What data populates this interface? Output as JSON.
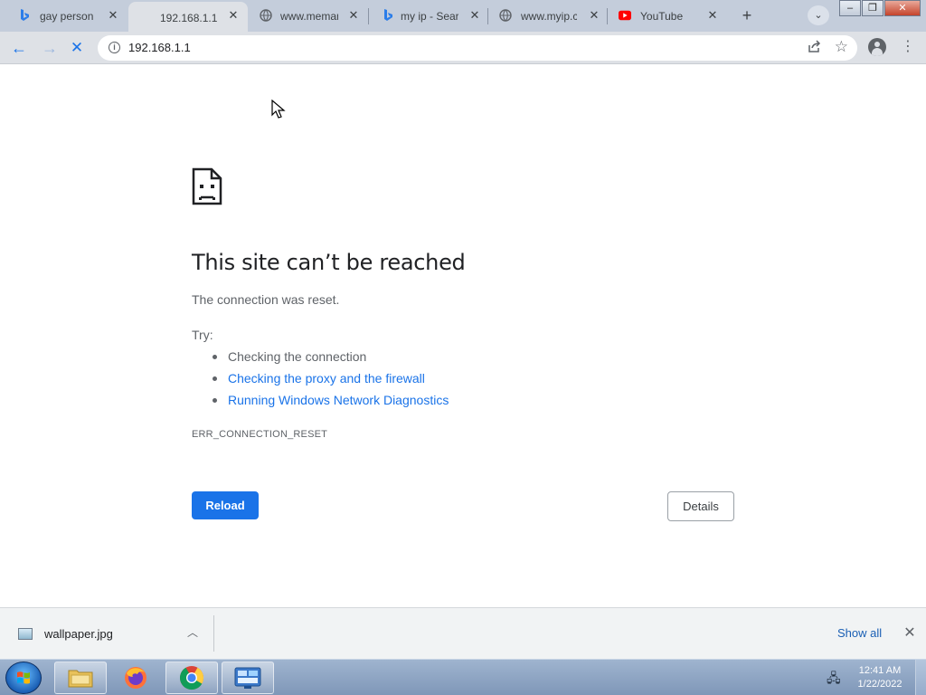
{
  "tabs": [
    {
      "title": "gay person",
      "favicon": "bing-icon",
      "active": false
    },
    {
      "title": "192.168.1.1",
      "favicon": "none",
      "active": true
    },
    {
      "title": "www.meman",
      "favicon": "globe-icon",
      "active": false
    },
    {
      "title": "my ip - Sear",
      "favicon": "bing-icon",
      "active": false
    },
    {
      "title": "www.myip.c",
      "favicon": "globe-icon",
      "active": false
    },
    {
      "title": "YouTube",
      "favicon": "youtube-icon",
      "active": false
    }
  ],
  "toolbar": {
    "url": "192.168.1.1"
  },
  "error_page": {
    "title": "This site can’t be reached",
    "description": "The connection was reset.",
    "try_label": "Try:",
    "suggestions": [
      {
        "text": "Checking the connection",
        "link": false
      },
      {
        "text": "Checking the proxy and the firewall",
        "link": true
      },
      {
        "text": "Running Windows Network Diagnostics",
        "link": true
      }
    ],
    "error_code": "ERR_CONNECTION_RESET",
    "reload_label": "Reload",
    "details_label": "Details"
  },
  "download_shelf": {
    "file_name": "wallpaper.jpg",
    "show_all_label": "Show all"
  },
  "taskbar": {
    "time": "12:41 AM",
    "date": "1/22/2022"
  },
  "colors": {
    "accent": "#1a73e8",
    "tabstrip": "#c4cddb",
    "toolbar": "#dee1e6"
  }
}
